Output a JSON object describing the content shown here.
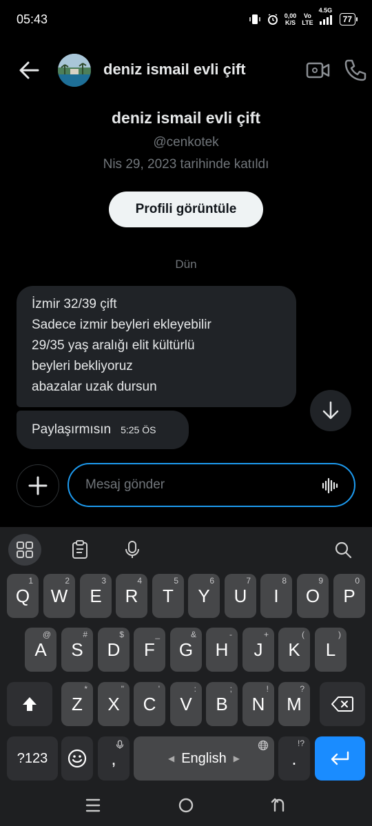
{
  "status_bar": {
    "time": "05:43",
    "speed_value": "0,00",
    "speed_unit": "K/S",
    "vo_label": "Vo",
    "lte_label": "LTE",
    "network": "4.5G",
    "battery": "77"
  },
  "header": {
    "title": "deniz ismail evli çift"
  },
  "profile": {
    "name": "deniz ismail evli çift",
    "handle": "@cenkotek",
    "joined": "Nis 29, 2023 tarihinde katıldı",
    "view_profile_label": "Profili görüntüle"
  },
  "conversation": {
    "day_label": "Dün",
    "message1_lines": [
      "İzmir 32/39 çift",
      "Sadece izmir beyleri ekleyebilir",
      "29/35 yaş aralığı elit kültürlü",
      "beyleri bekliyoruz",
      "abazalar uzak dursun"
    ],
    "message2_text": "Paylaşırmısın",
    "message2_time": "5:25 ÖS"
  },
  "composer": {
    "placeholder": "Mesaj gönder"
  },
  "keyboard": {
    "row1": [
      {
        "key": "Q",
        "sup": "1"
      },
      {
        "key": "W",
        "sup": "2"
      },
      {
        "key": "E",
        "sup": "3"
      },
      {
        "key": "R",
        "sup": "4"
      },
      {
        "key": "T",
        "sup": "5"
      },
      {
        "key": "Y",
        "sup": "6"
      },
      {
        "key": "U",
        "sup": "7"
      },
      {
        "key": "I",
        "sup": "8"
      },
      {
        "key": "O",
        "sup": "9"
      },
      {
        "key": "P",
        "sup": "0"
      }
    ],
    "row2": [
      {
        "key": "A",
        "sup": "@"
      },
      {
        "key": "S",
        "sup": "#"
      },
      {
        "key": "D",
        "sup": "$"
      },
      {
        "key": "F",
        "sup": "_"
      },
      {
        "key": "G",
        "sup": "&"
      },
      {
        "key": "H",
        "sup": "-"
      },
      {
        "key": "J",
        "sup": "+"
      },
      {
        "key": "K",
        "sup": "("
      },
      {
        "key": "L",
        "sup": ")"
      }
    ],
    "row3": [
      {
        "key": "Z",
        "sup": "*"
      },
      {
        "key": "X",
        "sup": "\""
      },
      {
        "key": "C",
        "sup": "'"
      },
      {
        "key": "V",
        "sup": ":"
      },
      {
        "key": "B",
        "sup": ";"
      },
      {
        "key": "N",
        "sup": "!"
      },
      {
        "key": "M",
        "sup": "?"
      }
    ],
    "symbols_label": "?123",
    "comma_label": ",",
    "space_label": "English",
    "period_label": ".",
    "period_sup": "!?"
  },
  "colors": {
    "accent": "#1d9bf0",
    "enter_key": "#1a8cff",
    "bubble": "#202327",
    "key": "#464749"
  },
  "icons": {
    "back": "arrow-left-icon",
    "video": "video-camera-icon",
    "call": "phone-icon",
    "add": "plus-icon",
    "voice": "voice-wave-icon",
    "scroll": "arrow-down-icon"
  }
}
